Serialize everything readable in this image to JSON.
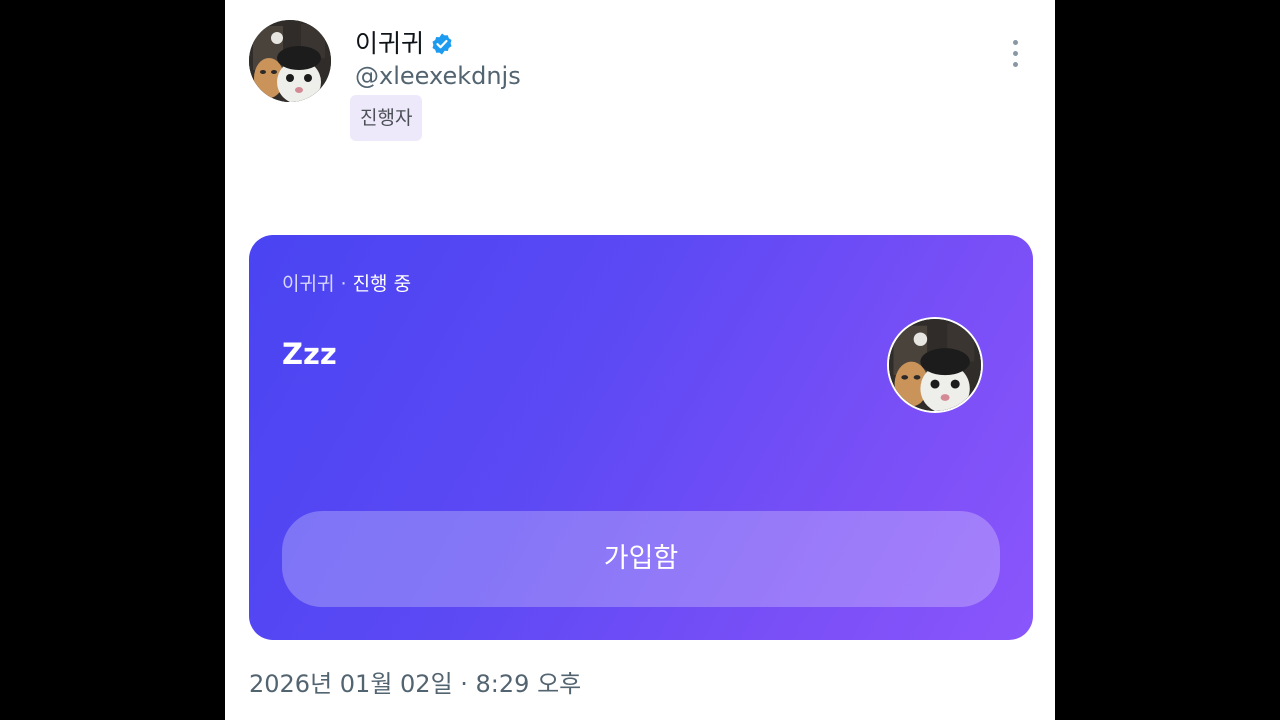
{
  "post": {
    "author": {
      "display_name": "이귀귀",
      "handle": "@xleexekdnjs",
      "role_badge": "진행자",
      "verified_icon": "verified-badge-icon"
    },
    "more_icon": "more-vertical-icon"
  },
  "space_card": {
    "host_name": "이귀귀",
    "separator": " · ",
    "status": "진행 중",
    "title": "Zzz",
    "join_label": "가입함",
    "gradient_start": "#4a44f2",
    "gradient_end": "#8a56fb"
  },
  "timestamp": "2026년 01월 02일 · 8:29 오후",
  "colors": {
    "verified": "#1d9bf0",
    "role_badge_bg": "#ede9fb"
  }
}
